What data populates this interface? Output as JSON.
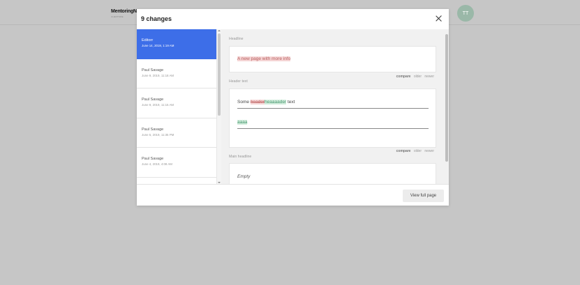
{
  "app": {
    "brand": "MentoringN",
    "brand_sub": "CLIENTSIDE",
    "avatar_initials": "TT"
  },
  "modal": {
    "title": "9 changes",
    "close_icon": "close-icon",
    "revisions": [
      {
        "author": "Editorr",
        "date": "June 14, 2019, 1:19 AM",
        "active": true
      },
      {
        "author": "Paul Savage",
        "date": "June 9, 2019, 11:18 AM",
        "active": false
      },
      {
        "author": "Paul Savage",
        "date": "June 9, 2019, 11:15 AM",
        "active": false
      },
      {
        "author": "Paul Savage",
        "date": "June 5, 2019, 11:35 PM",
        "active": false
      },
      {
        "author": "Paul Savage",
        "date": "June 4, 2019, 4:08 AM",
        "active": false
      }
    ],
    "sections": {
      "headline": {
        "label": "Headline",
        "diff": "A new page with more info"
      },
      "header_text": {
        "label": "Header text",
        "line1_plain_before": "Some ",
        "line1_deleted": "header",
        "line1_inserted": "heaaaader",
        "line1_plain_after": " text",
        "line2_inserted": "aaaa"
      },
      "main_headline": {
        "label": "Main headline",
        "empty_text": "Empty"
      }
    },
    "links": {
      "compare": "compare",
      "older": "older",
      "newer": "newer"
    },
    "footer": {
      "view_full_page": "View full page"
    }
  },
  "colors": {
    "active_blue": "#3d6ee8",
    "deleted_bg": "#f5d5d5",
    "inserted_bg": "#d3eddd",
    "backdrop": "#c6c6c6"
  }
}
